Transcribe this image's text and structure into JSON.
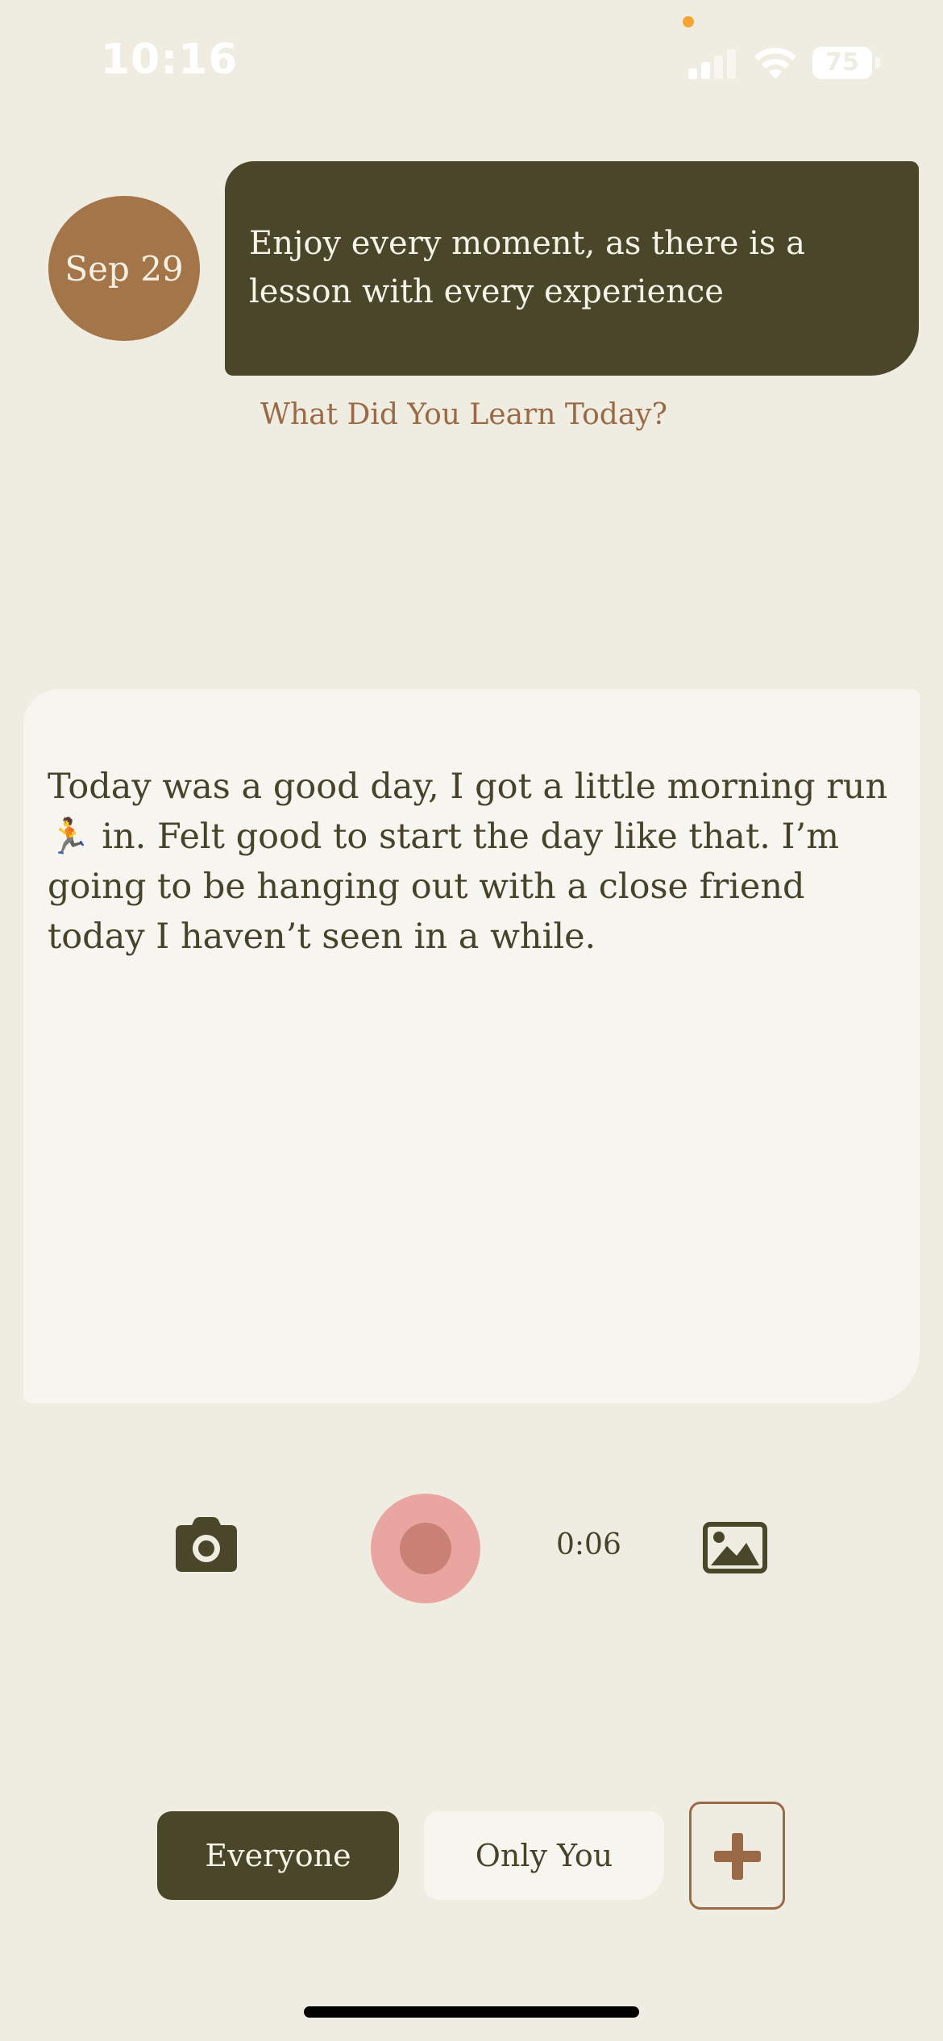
{
  "status_bar": {
    "time": "10:16",
    "battery": "75"
  },
  "entry": {
    "date_label": "Sep 29",
    "quote": "Enjoy every moment, as there is a lesson with every experience",
    "prompt": "What Did You Learn Today?",
    "body_text": "Today was a good day, I got a little morning run 🏃 in. Felt good to start the day like that. I’m going to be hanging out with a close friend today I haven’t seen in a while."
  },
  "recorder": {
    "timer": "0:06",
    "icons": {
      "camera": "camera-icon",
      "record": "record-icon",
      "gallery": "image-icon"
    }
  },
  "audience": {
    "everyone_label": "Everyone",
    "only_you_label": "Only You",
    "selected": "Everyone",
    "add_icon": "plus-icon"
  },
  "colors": {
    "background": "#EFEDE1",
    "accent_dark": "#4A4629",
    "accent_brown": "#A47549",
    "prompt_brown": "#9A6A47",
    "record_outer": "#E9A6A0",
    "record_inner": "#CA8175"
  }
}
